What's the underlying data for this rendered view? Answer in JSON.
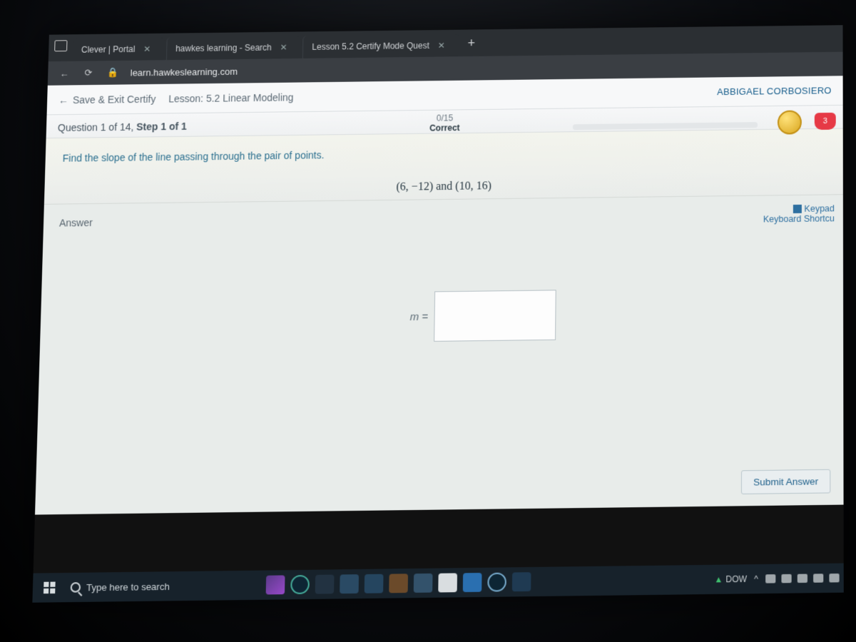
{
  "browser": {
    "tabs": [
      {
        "title": "Clever | Portal"
      },
      {
        "title": "hawkes learning - Search"
      },
      {
        "title": "Lesson 5.2 Certify Mode Quest"
      }
    ],
    "new_tab_glyph": "+",
    "url_domain": "learn.hawkeslearning.com",
    "url_path": ""
  },
  "hawkes": {
    "save_exit": "Save & Exit Certify",
    "lesson_label": "Lesson: 5.2 Linear Modeling",
    "user_name": "ABBIGAEL CORBOSIERO"
  },
  "question": {
    "title_prefix": "Question 1 of 14, ",
    "title_bold": "Step 1 of 1",
    "score_frac": "0/15",
    "score_label": "Correct",
    "heart_count": "3"
  },
  "problem": {
    "prompt": "Find the slope of the line passing through the pair of points.",
    "points_expr": "(6, −12) and (10, 16)"
  },
  "answer": {
    "section_label": "Answer",
    "keypad": "Keypad",
    "kb_shortcuts": "Keyboard Shortcu",
    "lhs": "m =",
    "submit": "Submit Answer"
  },
  "taskbar": {
    "search_placeholder": "Type here to search",
    "stock_symbol": "DOW",
    "tray_caret": "^"
  }
}
